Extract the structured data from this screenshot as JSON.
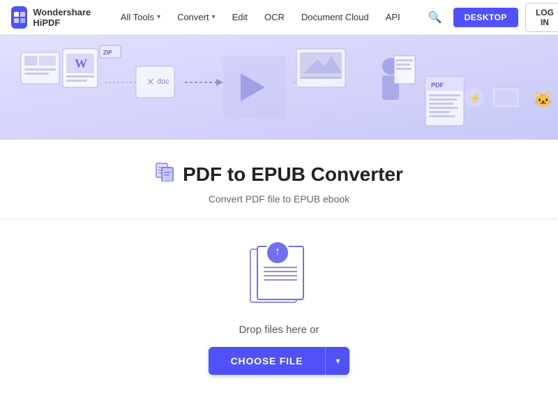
{
  "brand": {
    "name": "Wondershare HiPDF",
    "logo_alt": "HiPDF Logo"
  },
  "navbar": {
    "all_tools_label": "All Tools",
    "convert_label": "Convert",
    "edit_label": "Edit",
    "ocr_label": "OCR",
    "document_cloud_label": "Document Cloud",
    "api_label": "API",
    "desktop_btn": "DESKTOP",
    "login_btn": "LOG IN"
  },
  "page": {
    "title": "PDF to EPUB Converter",
    "subtitle": "Convert PDF file to EPUB ebook",
    "drop_text": "Drop files here or",
    "choose_file_btn": "CHOOSE FILE"
  },
  "icons": {
    "search": "🔍",
    "chevron_down": "▾",
    "upload_arrow": "↑"
  }
}
